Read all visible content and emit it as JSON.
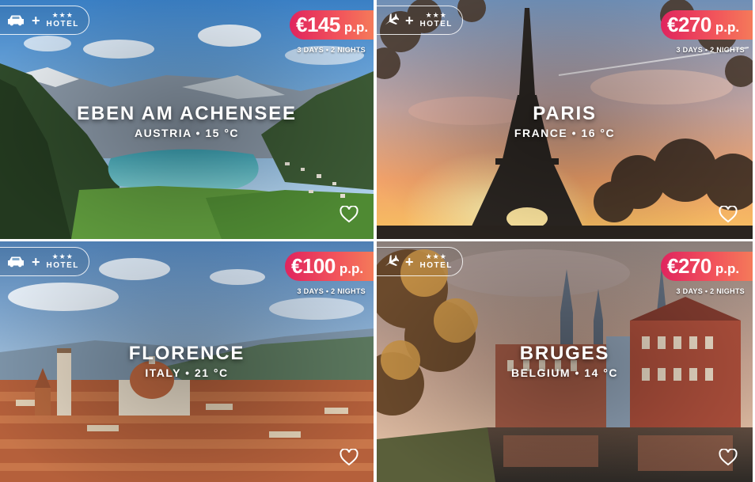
{
  "cards": [
    {
      "transport": "car-icon",
      "plus": "+",
      "stars": "★★★",
      "hotel": "HOTEL",
      "price": "€145",
      "unit": "p.p.",
      "duration": "3 DAYS • 2 NIGHTS",
      "city": "EBEN AM ACHENSEE",
      "subtitle": "AUSTRIA • 15 °C"
    },
    {
      "transport": "plane-icon",
      "plus": "+",
      "stars": "★★★",
      "hotel": "HOTEL",
      "price": "€270",
      "unit": "p.p.",
      "duration": "3 DAYS • 2 NIGHTS",
      "city": "PARIS",
      "subtitle": "FRANCE • 16 °C"
    },
    {
      "transport": "car-icon",
      "plus": "+",
      "stars": "★★★",
      "hotel": "HOTEL",
      "price": "€100",
      "unit": "p.p.",
      "duration": "3 DAYS • 2 NIGHTS",
      "city": "FLORENCE",
      "subtitle": "ITALY • 21 °C"
    },
    {
      "transport": "plane-icon",
      "plus": "+",
      "stars": "★★★",
      "hotel": "HOTEL",
      "price": "€270",
      "unit": "p.p.",
      "duration": "3 DAYS • 2 NIGHTS",
      "city": "BRUGES",
      "subtitle": "BELGIUM • 14 °C"
    }
  ],
  "colors": {
    "price_start": "#e0245e",
    "price_end": "#f47a5a"
  }
}
